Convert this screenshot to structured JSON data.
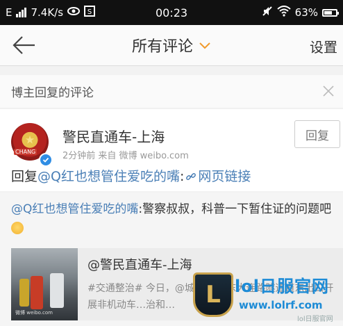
{
  "status_bar": {
    "carrier": "E",
    "speed": "7.4K/s",
    "time": "00:23",
    "battery": "63%"
  },
  "nav": {
    "title": "所有评论",
    "settings": "设置"
  },
  "section": {
    "title": "博主回复的评论"
  },
  "comment": {
    "avatar_label": "CHANG",
    "username": "警民直通车-上海",
    "meta": "2分钟前  来自 微博 weibo.com",
    "reply_button": "回复",
    "reply_prefix": "回复",
    "reply_mention": "@Q红也想管住爱吃的嘴",
    "reply_sep": ":",
    "reply_link": "网页链接"
  },
  "original": {
    "mention": "@Q红也想管住爱吃的嘴",
    "text": ":警察叔叔，科普一下暂住证的问题吧",
    "repost_title": "@警民直通车-上海",
    "repost_body": "#交通整治# 今日，@城市交警 东大连路隧道道东出口开展非机动车…治和…",
    "thumb_watermark": "微博 weibo.com"
  },
  "watermark": {
    "name": "lol日服官网",
    "url": "www.lolrf.com",
    "tag": "lol日服官网"
  },
  "colors": {
    "link": "#4a7fb6",
    "status_bg": "#111111",
    "verify_blue": "#2f8de4"
  }
}
